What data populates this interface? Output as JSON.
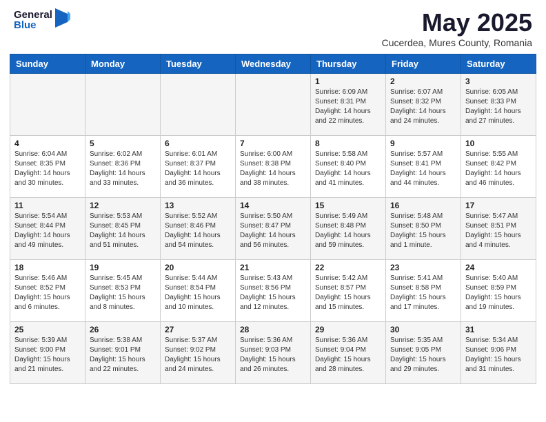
{
  "header": {
    "logo_general": "General",
    "logo_blue": "Blue",
    "title": "May 2025",
    "subtitle": "Cucerdea, Mures County, Romania"
  },
  "weekdays": [
    "Sunday",
    "Monday",
    "Tuesday",
    "Wednesday",
    "Thursday",
    "Friday",
    "Saturday"
  ],
  "weeks": [
    [
      {
        "day": "",
        "info": ""
      },
      {
        "day": "",
        "info": ""
      },
      {
        "day": "",
        "info": ""
      },
      {
        "day": "",
        "info": ""
      },
      {
        "day": "1",
        "info": "Sunrise: 6:09 AM\nSunset: 8:31 PM\nDaylight: 14 hours\nand 22 minutes."
      },
      {
        "day": "2",
        "info": "Sunrise: 6:07 AM\nSunset: 8:32 PM\nDaylight: 14 hours\nand 24 minutes."
      },
      {
        "day": "3",
        "info": "Sunrise: 6:05 AM\nSunset: 8:33 PM\nDaylight: 14 hours\nand 27 minutes."
      }
    ],
    [
      {
        "day": "4",
        "info": "Sunrise: 6:04 AM\nSunset: 8:35 PM\nDaylight: 14 hours\nand 30 minutes."
      },
      {
        "day": "5",
        "info": "Sunrise: 6:02 AM\nSunset: 8:36 PM\nDaylight: 14 hours\nand 33 minutes."
      },
      {
        "day": "6",
        "info": "Sunrise: 6:01 AM\nSunset: 8:37 PM\nDaylight: 14 hours\nand 36 minutes."
      },
      {
        "day": "7",
        "info": "Sunrise: 6:00 AM\nSunset: 8:38 PM\nDaylight: 14 hours\nand 38 minutes."
      },
      {
        "day": "8",
        "info": "Sunrise: 5:58 AM\nSunset: 8:40 PM\nDaylight: 14 hours\nand 41 minutes."
      },
      {
        "day": "9",
        "info": "Sunrise: 5:57 AM\nSunset: 8:41 PM\nDaylight: 14 hours\nand 44 minutes."
      },
      {
        "day": "10",
        "info": "Sunrise: 5:55 AM\nSunset: 8:42 PM\nDaylight: 14 hours\nand 46 minutes."
      }
    ],
    [
      {
        "day": "11",
        "info": "Sunrise: 5:54 AM\nSunset: 8:44 PM\nDaylight: 14 hours\nand 49 minutes."
      },
      {
        "day": "12",
        "info": "Sunrise: 5:53 AM\nSunset: 8:45 PM\nDaylight: 14 hours\nand 51 minutes."
      },
      {
        "day": "13",
        "info": "Sunrise: 5:52 AM\nSunset: 8:46 PM\nDaylight: 14 hours\nand 54 minutes."
      },
      {
        "day": "14",
        "info": "Sunrise: 5:50 AM\nSunset: 8:47 PM\nDaylight: 14 hours\nand 56 minutes."
      },
      {
        "day": "15",
        "info": "Sunrise: 5:49 AM\nSunset: 8:48 PM\nDaylight: 14 hours\nand 59 minutes."
      },
      {
        "day": "16",
        "info": "Sunrise: 5:48 AM\nSunset: 8:50 PM\nDaylight: 15 hours\nand 1 minute."
      },
      {
        "day": "17",
        "info": "Sunrise: 5:47 AM\nSunset: 8:51 PM\nDaylight: 15 hours\nand 4 minutes."
      }
    ],
    [
      {
        "day": "18",
        "info": "Sunrise: 5:46 AM\nSunset: 8:52 PM\nDaylight: 15 hours\nand 6 minutes."
      },
      {
        "day": "19",
        "info": "Sunrise: 5:45 AM\nSunset: 8:53 PM\nDaylight: 15 hours\nand 8 minutes."
      },
      {
        "day": "20",
        "info": "Sunrise: 5:44 AM\nSunset: 8:54 PM\nDaylight: 15 hours\nand 10 minutes."
      },
      {
        "day": "21",
        "info": "Sunrise: 5:43 AM\nSunset: 8:56 PM\nDaylight: 15 hours\nand 12 minutes."
      },
      {
        "day": "22",
        "info": "Sunrise: 5:42 AM\nSunset: 8:57 PM\nDaylight: 15 hours\nand 15 minutes."
      },
      {
        "day": "23",
        "info": "Sunrise: 5:41 AM\nSunset: 8:58 PM\nDaylight: 15 hours\nand 17 minutes."
      },
      {
        "day": "24",
        "info": "Sunrise: 5:40 AM\nSunset: 8:59 PM\nDaylight: 15 hours\nand 19 minutes."
      }
    ],
    [
      {
        "day": "25",
        "info": "Sunrise: 5:39 AM\nSunset: 9:00 PM\nDaylight: 15 hours\nand 21 minutes."
      },
      {
        "day": "26",
        "info": "Sunrise: 5:38 AM\nSunset: 9:01 PM\nDaylight: 15 hours\nand 22 minutes."
      },
      {
        "day": "27",
        "info": "Sunrise: 5:37 AM\nSunset: 9:02 PM\nDaylight: 15 hours\nand 24 minutes."
      },
      {
        "day": "28",
        "info": "Sunrise: 5:36 AM\nSunset: 9:03 PM\nDaylight: 15 hours\nand 26 minutes."
      },
      {
        "day": "29",
        "info": "Sunrise: 5:36 AM\nSunset: 9:04 PM\nDaylight: 15 hours\nand 28 minutes."
      },
      {
        "day": "30",
        "info": "Sunrise: 5:35 AM\nSunset: 9:05 PM\nDaylight: 15 hours\nand 29 minutes."
      },
      {
        "day": "31",
        "info": "Sunrise: 5:34 AM\nSunset: 9:06 PM\nDaylight: 15 hours\nand 31 minutes."
      }
    ]
  ]
}
